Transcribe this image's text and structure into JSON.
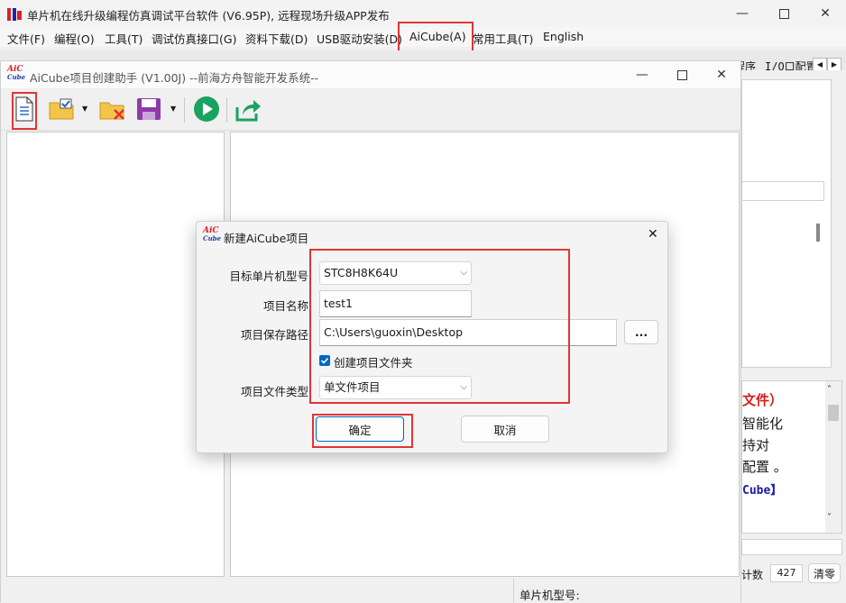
{
  "outer": {
    "title": "单片机在线升级编程仿真调试平台软件 (V6.95P), 远程现场升级APP发布",
    "menu": [
      "文件(F)",
      "编程(O)",
      "工具(T)",
      "调试仿真接口(G)",
      "资料下载(D)",
      "USB驱动安装(D)",
      "AiCube(A)",
      "常用工具(T)",
      "English"
    ],
    "tabs_right": [
      "程序",
      "I/O口配置"
    ],
    "right_panel": {
      "line1": "文件）",
      "line2": "智能化",
      "line3": "持对",
      "line4": "配置 。",
      "line5": "Cube】",
      "count_label": "计数",
      "count_value": "427",
      "clear_label": "清零"
    }
  },
  "inner": {
    "title": "AiCube项目创建助手 (V1.00J) --前海方舟智能开发系统--",
    "logo_text": "AiC Cube",
    "status_label": "单片机型号:"
  },
  "dialog": {
    "title": "新建AiCube项目",
    "mcu_label": "目标单片机型号",
    "mcu_value": "STC8H8K64U",
    "name_label": "项目名称",
    "name_value": "test1",
    "path_label": "项目保存路径",
    "path_value": "C:\\Users\\guoxin\\Desktop",
    "browse_label": "...",
    "create_folder_label": "创建项目文件夹",
    "create_folder_checked": true,
    "type_label": "项目文件类型",
    "type_value": "单文件项目",
    "ok_label": "确定",
    "cancel_label": "取消"
  },
  "colors": {
    "highlight": "#e03535",
    "accent": "#0067c0",
    "run_green": "#1aa260"
  }
}
